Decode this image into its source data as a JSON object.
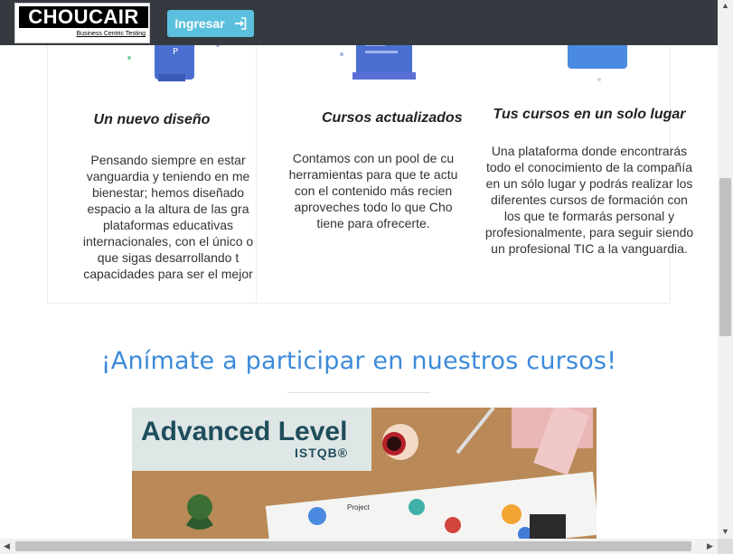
{
  "navbar": {
    "logo_name": "CHOUCAIR",
    "logo_tagline": "Business Centric Testing",
    "login_label": "Ingresar",
    "login_icon": "sign-in-icon"
  },
  "features": [
    {
      "title": "Un nuevo diseño",
      "lines": [
        "Pensando siempre en estar",
        "vanguardia y teniendo en me",
        "bienestar; hemos diseñado",
        "espacio a la altura de las gra",
        "plataformas educativas",
        "internacionales, con el único o",
        "que sigas desarrollando t",
        "capacidades para ser el mejor"
      ]
    },
    {
      "title": "Cursos actualizados",
      "lines": [
        "Contamos con un pool de cu",
        "herramientas para que te actu",
        "con el contenido más recien",
        "aproveches todo lo que Cho",
        "tiene para ofrecerte."
      ]
    },
    {
      "title": "Tus cursos en un solo lugar",
      "lines": [
        "Una plataforma donde encontrarás",
        "todo el conocimiento de la compañía",
        "en un sólo lugar y podrás realizar los",
        "diferentes cursos de formación con",
        "los que te formarás personal y",
        "profesionalmente, para seguir siendo",
        "un profesional TIC a la vanguardia."
      ]
    }
  ],
  "cta": {
    "title": "¡Anímate a participar en nuestros cursos!"
  },
  "course_banner": {
    "title": "Advanced Level",
    "subtitle": "ISTQB®",
    "diagram_label": "Project"
  },
  "colors": {
    "navbar": "#343a40",
    "login_button": "#5bc0de",
    "cta_title": "#3c8ad9",
    "banner_text": "#1f4e5c"
  }
}
